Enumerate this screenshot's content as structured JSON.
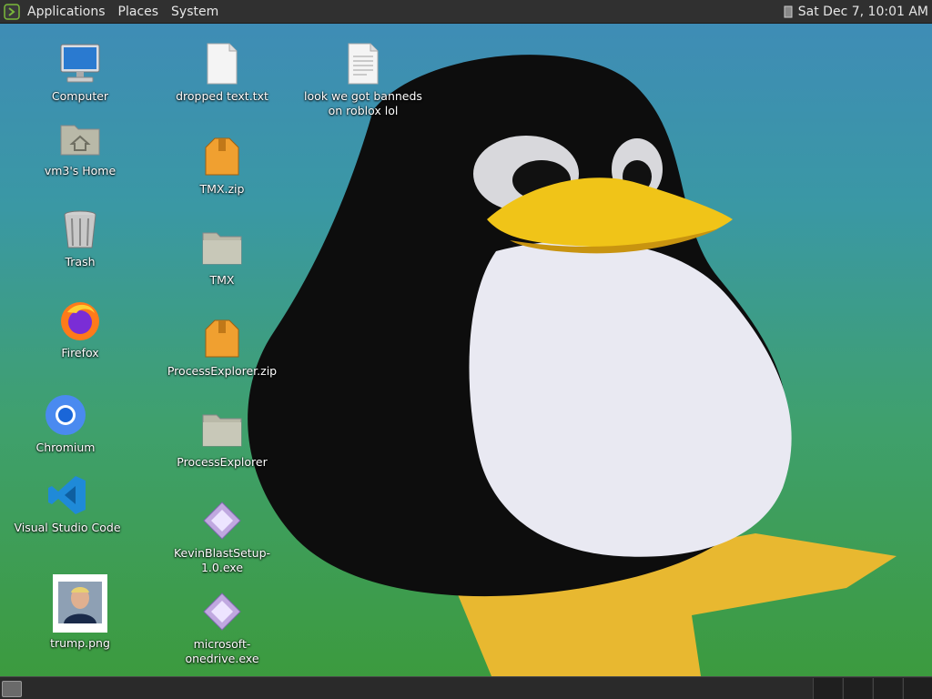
{
  "top_panel": {
    "menu": [
      "Applications",
      "Places",
      "System"
    ],
    "clock": "Sat Dec  7, 10:01 AM"
  },
  "desktop": {
    "icons": [
      {
        "label": "Computer",
        "icon": "computer-icon"
      },
      {
        "label": "vm3's Home",
        "icon": "home-folder-icon"
      },
      {
        "label": "Trash",
        "icon": "trash-icon"
      },
      {
        "label": "Firefox",
        "icon": "firefox-icon"
      },
      {
        "label": "Chromium",
        "icon": "chromium-icon"
      },
      {
        "label": "Visual Studio Code",
        "icon": "vscode-icon"
      },
      {
        "label": "trump.png",
        "icon": "image-thumbnail-icon"
      },
      {
        "label": "dropped text.txt",
        "icon": "text-file-icon"
      },
      {
        "label": "TMX.zip",
        "icon": "zip-archive-icon"
      },
      {
        "label": "TMX",
        "icon": "folder-icon"
      },
      {
        "label": "ProcessExplorer.zip",
        "icon": "zip-archive-icon"
      },
      {
        "label": "ProcessExplorer",
        "icon": "folder-icon"
      },
      {
        "label": "KevinBlastSetup-1.0.exe",
        "icon": "exe-file-icon"
      },
      {
        "label": "microsoft-onedrive.exe",
        "icon": "exe-file-icon"
      },
      {
        "label": "look we got banneds on roblox lol",
        "icon": "text-file-icon"
      }
    ]
  },
  "colors": {
    "panel": "#303030",
    "penguin_black": "#0c0c0c",
    "penguin_belly": "#e8e8f0",
    "penguin_beak": "#f0c020"
  }
}
